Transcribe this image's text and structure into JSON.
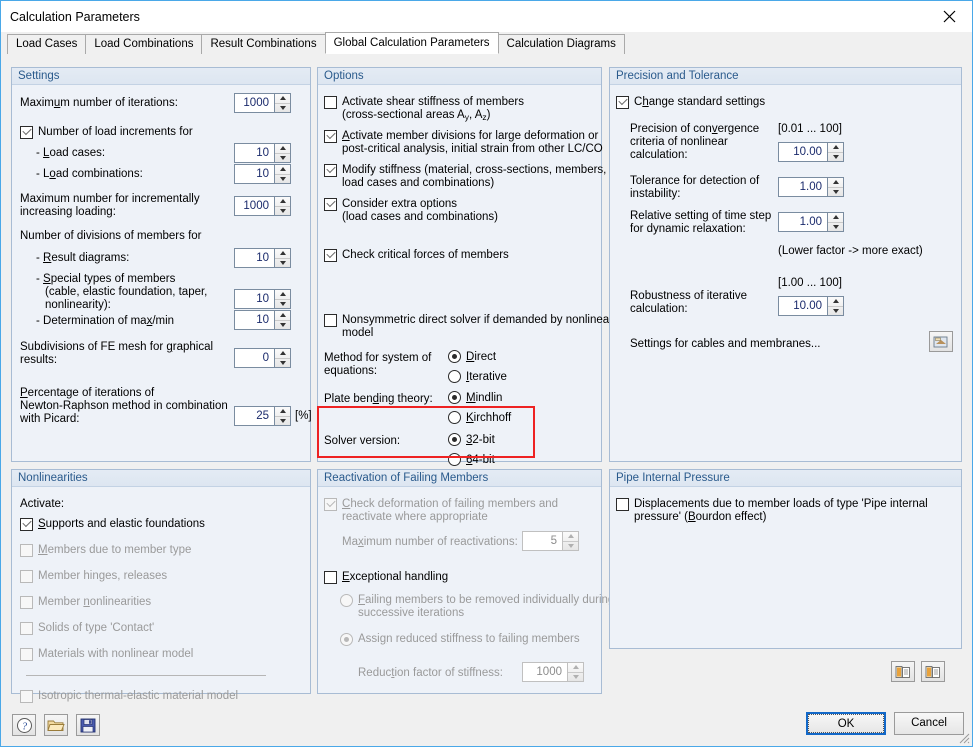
{
  "window": {
    "title": "Calculation Parameters",
    "close_icon": "close-icon"
  },
  "tabs": [
    {
      "label": "Load Cases",
      "active": false
    },
    {
      "label": "Load Combinations",
      "active": false
    },
    {
      "label": "Result Combinations",
      "active": false
    },
    {
      "label": "Global Calculation Parameters",
      "active": true
    },
    {
      "label": "Calculation Diagrams",
      "active": false
    }
  ],
  "settings": {
    "title": "Settings",
    "max_iterations_label": "Maximum number of iterations:",
    "max_iterations_value": "1000",
    "load_increments_label": "Number of load increments for",
    "load_increments_checked": true,
    "load_cases_label": "- Load cases:",
    "load_cases_value": "10",
    "load_combinations_label": "- Load combinations:",
    "load_combinations_value": "10",
    "max_incremental_label_l1": "Maximum number for incrementally",
    "max_incremental_label_l2": "increasing loading:",
    "max_incremental_value": "1000",
    "divisions_label": "Number of divisions of members for",
    "result_diagrams_label": "- Result diagrams:",
    "result_diagrams_value": "10",
    "special_types_l1": "- Special types of members",
    "special_types_l2": "(cable, elastic foundation, taper,",
    "special_types_l3": "nonlinearity):",
    "special_types_value": "10",
    "max_min_label": "- Determination of max/min",
    "max_min_value": "10",
    "subdivisions_l1": "Subdivisions of FE mesh for graphical",
    "subdivisions_l2": "results:",
    "subdivisions_value": "0",
    "percentage_l1": "Percentage of iterations of",
    "percentage_l2": "Newton-Raphson method in combination",
    "percentage_l3": "with Picard:",
    "percentage_value": "25",
    "percentage_unit": "[%]"
  },
  "options": {
    "title": "Options",
    "shear_stiffness_l1": "Activate shear stiffness of members",
    "shear_stiffness_l2_a": "(cross-sectional areas A",
    "shear_stiffness_sub1": "y",
    "shear_stiffness_l2_b": ", A",
    "shear_stiffness_sub2": "z",
    "shear_stiffness_l2_c": ")",
    "shear_stiffness_checked": false,
    "member_divisions_l1": "Activate member divisions for large deformation or",
    "member_divisions_l2": "post-critical analysis, initial strain from other LC/CO",
    "member_divisions_checked": true,
    "modify_stiffness_l1": "Modify stiffness (material, cross-sections, members,",
    "modify_stiffness_l2": "load cases and combinations)",
    "modify_stiffness_checked": true,
    "extra_options_l1": "Consider extra options",
    "extra_options_l2": "(load cases and combinations)",
    "extra_options_checked": true,
    "critical_forces_label": "Check critical forces of members",
    "critical_forces_checked": true,
    "nonsymmetric_l1": "Nonsymmetric direct solver if demanded by nonlinear",
    "nonsymmetric_l2": "model",
    "nonsymmetric_checked": false,
    "method_label_l1": "Method for system of",
    "method_label_l2": "equations:",
    "method_options": [
      {
        "label": "Direct",
        "selected": true
      },
      {
        "label": "Iterative",
        "selected": false
      }
    ],
    "plate_label": "Plate bending theory:",
    "plate_options": [
      {
        "label": "Mindlin",
        "selected": true
      },
      {
        "label": "Kirchhoff",
        "selected": false
      }
    ],
    "solver_label": "Solver version:",
    "solver_options": [
      {
        "label": "32-bit",
        "selected": true
      },
      {
        "label": "64-bit",
        "selected": false
      }
    ],
    "solver_highlight_color": "#ee2222"
  },
  "precision": {
    "title": "Precision and Tolerance",
    "change_standard_label": "Change standard settings",
    "change_standard_checked": true,
    "convergence_l1": "Precision of convergence",
    "convergence_l2": "criteria of nonlinear",
    "convergence_l3": "calculation:",
    "convergence_range": "[0.01 ... 100]",
    "convergence_value": "10.00",
    "instability_l1": "Tolerance for detection of",
    "instability_l2": "instability:",
    "instability_value": "1.00",
    "timestep_l1": "Relative setting of time step",
    "timestep_l2": "for dynamic relaxation:",
    "timestep_value": "1.00",
    "timestep_note": "(Lower factor -> more exact)",
    "robustness_range": "[1.00 ... 100]",
    "robustness_l1": "Robustness of iterative",
    "robustness_l2": "calculation:",
    "robustness_value": "10.00",
    "cables_membranes_label": "Settings for cables and membranes...",
    "cables_membranes_icon": "settings-dialog-icon"
  },
  "nonlinearities": {
    "title": "Nonlinearities",
    "activate_label": "Activate:",
    "items": [
      {
        "label": "Supports and elastic foundations",
        "checked": true,
        "enabled": true
      },
      {
        "label": "Members due to member type",
        "checked": false,
        "enabled": false
      },
      {
        "label": "Member hinges, releases",
        "checked": false,
        "enabled": false
      },
      {
        "label": "Member nonlinearities",
        "checked": false,
        "enabled": false
      },
      {
        "label": "Solids of type 'Contact'",
        "checked": false,
        "enabled": false
      },
      {
        "label": "Materials with nonlinear model",
        "checked": false,
        "enabled": false
      }
    ],
    "isotropic_label": "Isotropic thermal-elastic material model",
    "isotropic_checked": false
  },
  "reactivation": {
    "title": "Reactivation of Failing Members",
    "check_deformation_l1": "Check deformation of failing members and",
    "check_deformation_l2": "reactivate where appropriate",
    "check_deformation_checked": true,
    "max_reactivations_label": "Maximum number of reactivations:",
    "max_reactivations_value": "5",
    "exceptional_label": "Exceptional handling",
    "exceptional_checked": false,
    "failing_removed_l1": "Failing members to be removed individually during",
    "failing_removed_l2": "successive iterations",
    "failing_removed_selected": false,
    "reduced_stiffness_label": "Assign reduced stiffness to failing members",
    "reduced_stiffness_selected": true,
    "reduction_factor_label": "Reduction factor of stiffness:",
    "reduction_factor_value": "1000"
  },
  "pipe": {
    "title": "Pipe Internal Pressure",
    "displacements_l1": "Displacements due to member loads of type 'Pipe internal",
    "displacements_l2": "pressure' (Bourdon effect)",
    "displacements_checked": false,
    "icon_left": "copy-to-icon",
    "icon_right": "copy-from-icon"
  },
  "footer": {
    "help_icon": "help-icon",
    "open_icon": "open-folder-icon",
    "save_icon": "save-disk-icon",
    "ok_label": "OK",
    "cancel_label": "Cancel"
  }
}
